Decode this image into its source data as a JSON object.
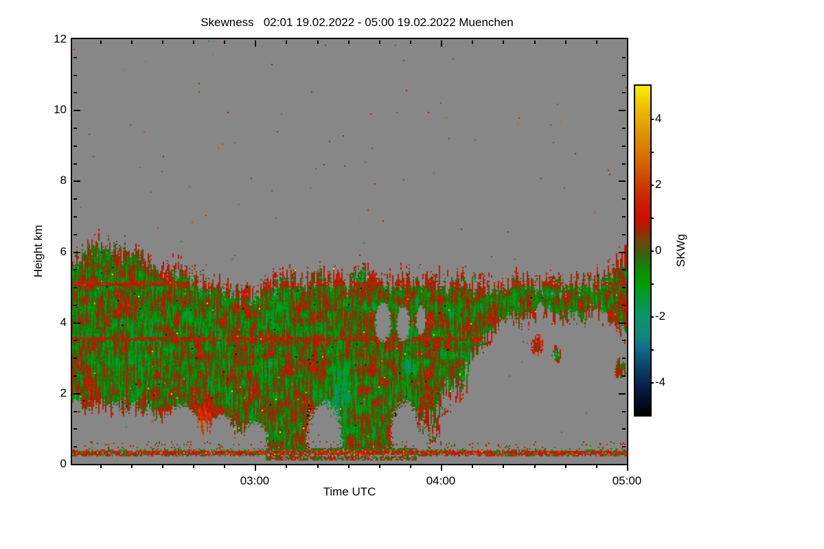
{
  "title": "Skewness   02:01 19.02.2022 - 05:00 19.02.2022 Muenchen",
  "chart_data": {
    "type": "heatmap",
    "title": "Skewness   02:01 19.02.2022 - 05:00 19.02.2022 Muenchen",
    "xlabel": "Time UTC",
    "ylabel": "Height km",
    "x_range_minutes": [
      121,
      300
    ],
    "x_ticks": [
      {
        "m": 180,
        "label": "03:00"
      },
      {
        "m": 240,
        "label": "04:00"
      },
      {
        "m": 300,
        "label": "05:00"
      }
    ],
    "x_minor_step_minutes": 10,
    "y_range_km": [
      0,
      12
    ],
    "y_ticks": [
      {
        "v": 0,
        "label": "0"
      },
      {
        "v": 2,
        "label": "2"
      },
      {
        "v": 4,
        "label": "4"
      },
      {
        "v": 6,
        "label": "6"
      },
      {
        "v": 8,
        "label": "8"
      },
      {
        "v": 10,
        "label": "10"
      },
      {
        "v": 12,
        "label": "12"
      }
    ],
    "y_minor_step_km": 0.5,
    "no_data_color": "#878787",
    "colorbar": {
      "label": "SKWg",
      "range": [
        -5,
        5
      ],
      "tick_labels": [
        {
          "v": 4,
          "label": "4"
        },
        {
          "v": 2,
          "label": "2"
        },
        {
          "v": 0,
          "label": "0"
        },
        {
          "v": -2,
          "label": "-2"
        },
        {
          "v": -4,
          "label": "-4"
        }
      ],
      "minor_step": 1,
      "stops": [
        [
          -5.0,
          "#000000"
        ],
        [
          -4.2,
          "#071a45"
        ],
        [
          -3.6,
          "#0c3f66"
        ],
        [
          -3.0,
          "#0f6a86"
        ],
        [
          -2.6,
          "#11867e"
        ],
        [
          -2.0,
          "#0c9468"
        ],
        [
          -1.4,
          "#009a33"
        ],
        [
          -1.0,
          "#009c00"
        ],
        [
          -0.7,
          "#079203"
        ],
        [
          -0.3,
          "#247010"
        ],
        [
          0.0,
          "#49570c"
        ],
        [
          0.3,
          "#6e4708"
        ],
        [
          0.6,
          "#9c2603"
        ],
        [
          0.95,
          "#c90d00"
        ],
        [
          1.4,
          "#cc1a00"
        ],
        [
          2.0,
          "#cc3c00"
        ],
        [
          2.8,
          "#d66d00"
        ],
        [
          3.6,
          "#e09500"
        ],
        [
          4.4,
          "#eec300"
        ],
        [
          5.0,
          "#f8f000"
        ]
      ]
    },
    "cloud_field": {
      "description": "Cloud radar skewness field: mixed olive-green/red turbulent cloud deck from ~0.3 km up to 5-6.3 km, precipitation to ground 03:04-03:52, elevated band ~4-5.3 km after 04:00, thin red surface echo line at ~0.3 km, gray = no data",
      "noise_seed": 42,
      "surface_band_km": [
        0.22,
        0.46
      ],
      "precip_minutes": [
        183.5,
        232
      ],
      "top_envelope": [
        [
          121,
          5.7
        ],
        [
          124,
          5.95
        ],
        [
          127,
          6.15
        ],
        [
          130,
          6.3
        ],
        [
          133,
          6.25
        ],
        [
          136,
          6.05
        ],
        [
          139,
          6.15
        ],
        [
          143,
          5.9
        ],
        [
          147,
          5.65
        ],
        [
          151,
          5.5
        ],
        [
          155,
          5.6
        ],
        [
          159,
          5.35
        ],
        [
          163,
          5.25
        ],
        [
          168,
          5.05
        ],
        [
          173,
          4.9
        ],
        [
          178,
          4.85
        ],
        [
          182,
          5.0
        ],
        [
          186,
          5.2
        ],
        [
          191,
          5.3
        ],
        [
          196,
          5.2
        ],
        [
          201,
          5.4
        ],
        [
          206,
          5.28
        ],
        [
          210,
          5.15
        ],
        [
          214,
          5.55
        ],
        [
          218,
          5.32
        ],
        [
          223,
          5.12
        ],
        [
          227,
          5.3
        ],
        [
          232,
          5.2
        ],
        [
          237,
          5.3
        ],
        [
          242,
          5.15
        ],
        [
          247,
          5.25
        ],
        [
          252,
          5.12
        ],
        [
          256,
          5.0
        ],
        [
          261,
          5.05
        ],
        [
          264,
          5.25
        ],
        [
          268,
          5.2
        ],
        [
          272,
          5.1
        ],
        [
          276,
          5.25
        ],
        [
          280,
          5.05
        ],
        [
          284,
          5.25
        ],
        [
          288,
          5.15
        ],
        [
          292,
          5.3
        ],
        [
          295,
          5.55
        ],
        [
          298,
          5.85
        ],
        [
          300,
          5.9
        ]
      ],
      "base_envelope": [
        [
          121,
          1.65
        ],
        [
          126,
          1.55
        ],
        [
          131,
          1.62
        ],
        [
          136,
          1.5
        ],
        [
          141,
          1.55
        ],
        [
          146,
          1.42
        ],
        [
          150,
          1.3
        ],
        [
          154,
          1.45
        ],
        [
          158,
          1.15
        ],
        [
          162,
          0.95
        ],
        [
          166,
          1.1
        ],
        [
          170,
          0.9
        ],
        [
          174,
          1.0
        ],
        [
          178,
          0.75
        ],
        [
          181,
          0.45
        ],
        [
          184,
          0.2
        ],
        [
          220,
          0.18
        ],
        [
          226,
          0.3
        ],
        [
          229,
          1.0
        ],
        [
          232,
          1.3
        ],
        [
          235,
          1.5
        ],
        [
          238,
          1.3
        ],
        [
          241,
          2.2
        ],
        [
          244,
          2.5
        ],
        [
          247,
          2.4
        ],
        [
          250,
          3.0
        ],
        [
          253,
          3.3
        ],
        [
          256,
          3.6
        ],
        [
          259,
          3.9
        ],
        [
          262,
          4.1
        ],
        [
          266,
          3.95
        ],
        [
          270,
          4.1
        ],
        [
          274,
          4.2
        ],
        [
          278,
          3.95
        ],
        [
          282,
          4.15
        ],
        [
          286,
          4.05
        ],
        [
          290,
          4.2
        ],
        [
          294,
          4.05
        ],
        [
          297,
          3.9
        ],
        [
          300,
          3.55
        ]
      ],
      "holes": [
        [
          156.5,
          0.9,
          11,
          1.5
        ],
        [
          169.5,
          0.75,
          7,
          1.3
        ],
        [
          180,
          0.65,
          8,
          1.1
        ],
        [
          202.5,
          0.75,
          11,
          1.9
        ],
        [
          228.5,
          0.8,
          9,
          1.9
        ],
        [
          221.3,
          4.0,
          5,
          1.1
        ],
        [
          227.8,
          3.95,
          4,
          1.0
        ],
        [
          233.5,
          4.05,
          3,
          0.8
        ],
        [
          272,
          4.28,
          2.5,
          0.55
        ]
      ],
      "patches": [
        [
          245.5,
          3.35,
          9,
          1.0,
          0
        ],
        [
          271,
          3.35,
          4,
          0.6,
          0.6
        ],
        [
          277.5,
          3.1,
          3,
          0.5,
          0
        ],
        [
          298,
          2.7,
          4,
          0.6,
          0
        ],
        [
          235.5,
          2.05,
          3,
          0.5,
          0
        ]
      ],
      "bias_regions": [
        [
          163,
          1.05,
          14,
          2.4,
          1.15
        ],
        [
          199,
          0.85,
          8,
          2.0,
          0.8
        ],
        [
          226,
          0.6,
          6,
          1.6,
          0.7
        ],
        [
          207,
          2.1,
          13,
          2.2,
          -0.95
        ],
        [
          155,
          1.0,
          5,
          2.0,
          -0.85
        ],
        [
          145,
          3.6,
          12,
          2.0,
          -0.5
        ],
        [
          166,
          3.7,
          8,
          1.2,
          -0.55
        ],
        [
          230,
          3.0,
          6,
          3.0,
          -0.5
        ],
        [
          265,
          4.65,
          30,
          1.0,
          -0.5
        ],
        [
          290,
          4.7,
          16,
          0.9,
          -0.4
        ],
        [
          186,
          4.3,
          10,
          1.4,
          -0.45
        ],
        [
          135,
          2.8,
          20,
          3.0,
          -0.25
        ]
      ],
      "red_lines": [
        [
          5.07,
          121,
          300,
          0.06,
          -0.75
        ],
        [
          3.52,
          121,
          256,
          0.055,
          -0.35
        ]
      ],
      "bright_spots": [
        [
          197.5,
          0.9,
          1.8,
          1.7
        ],
        [
          225.3,
          0.75,
          1.6,
          1.5
        ]
      ]
    }
  }
}
